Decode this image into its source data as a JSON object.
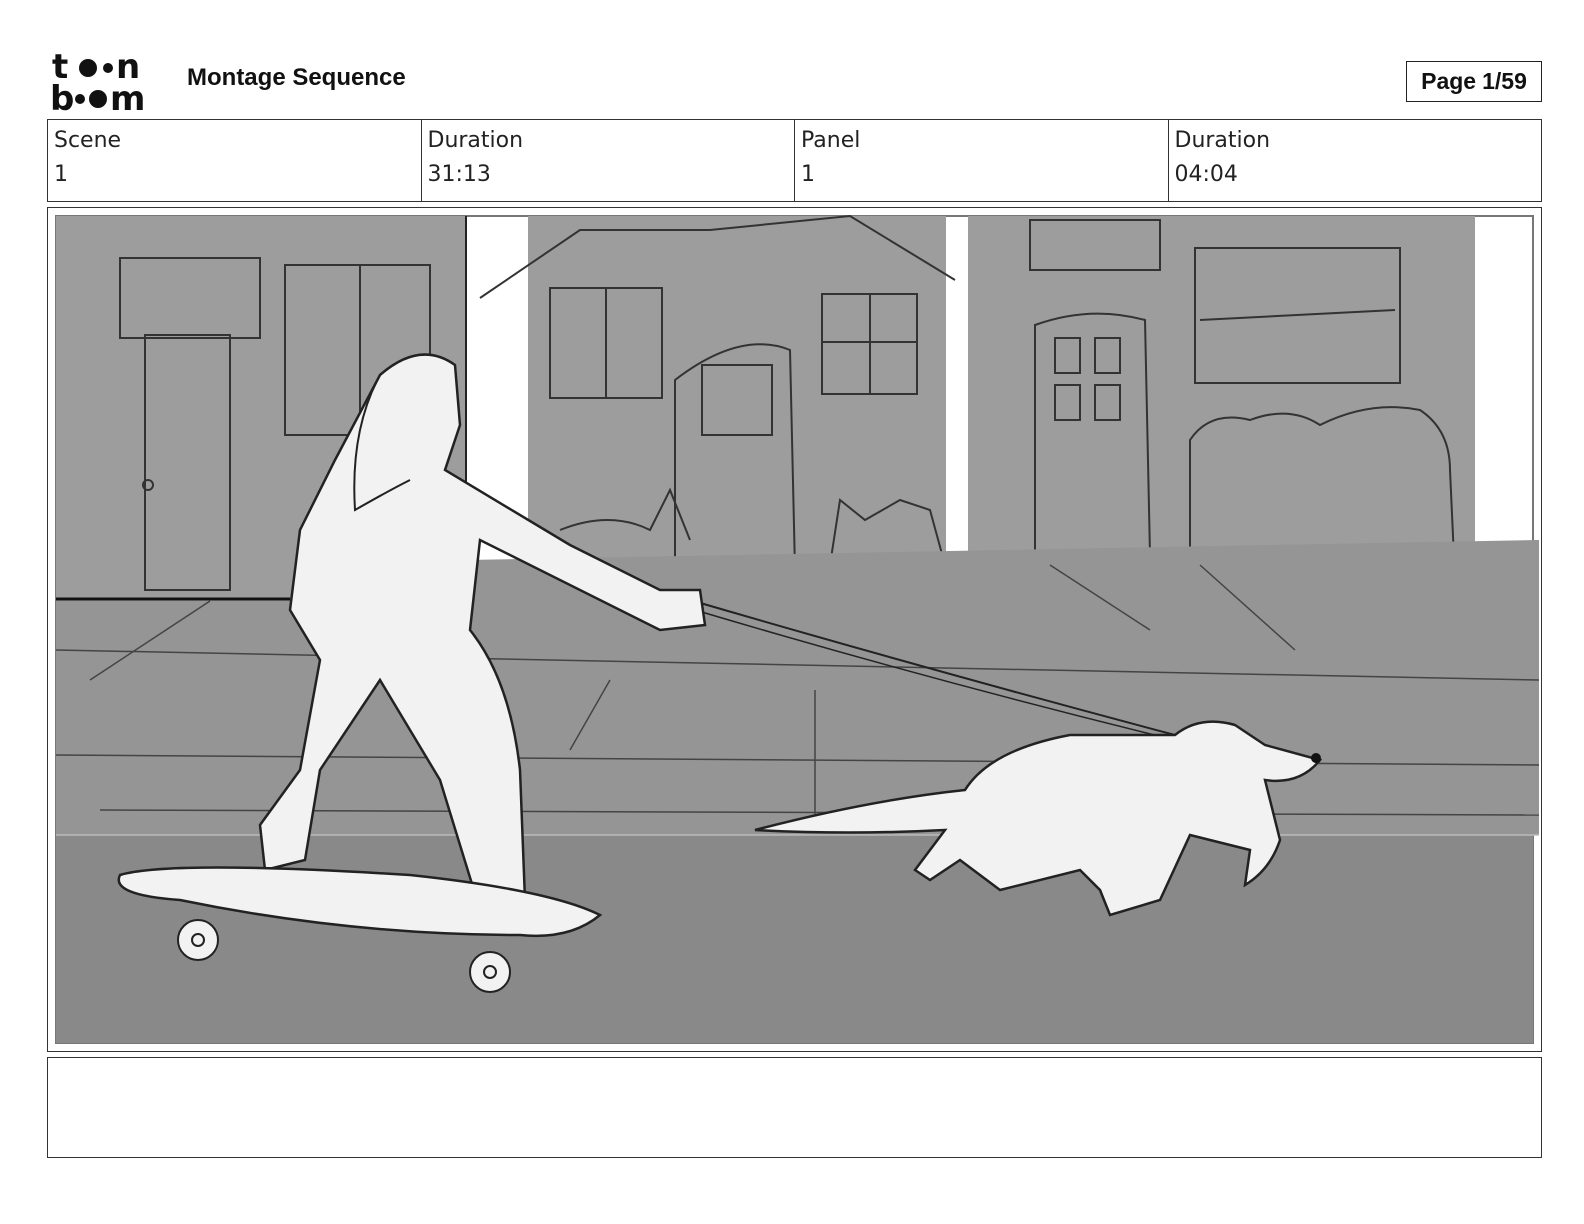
{
  "header": {
    "logo_text": "toonboom",
    "title": "Montage Sequence",
    "page_label": "Page",
    "page_number": "1/59"
  },
  "info": {
    "scene_label": "Scene",
    "scene_value": "1",
    "scene_duration_label": "Duration",
    "scene_duration_value": "31:13",
    "panel_label": "Panel",
    "panel_value": "1",
    "panel_duration_label": "Duration",
    "panel_duration_value": "04:04"
  },
  "panel_image": {
    "icon": "storyboard-sketch",
    "colors": {
      "building": "#9d9d9d",
      "sidewalk": "#959595",
      "road": "#898989",
      "sky": "#ffffff",
      "line": "#2a2a2a"
    }
  },
  "caption": {
    "text": ""
  }
}
